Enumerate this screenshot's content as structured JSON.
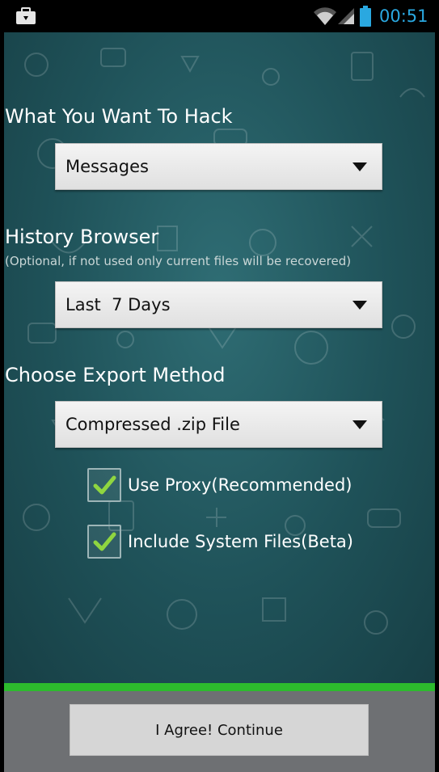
{
  "status_bar": {
    "time": "00:51",
    "left_icon": "briefcase-icon",
    "wifi_icon": "wifi-icon",
    "signal_icon": "signal-icon",
    "battery_icon": "battery-icon",
    "time_color": "#2aa8e0"
  },
  "form": {
    "hack_section": {
      "title": "What You Want To Hack",
      "selected": "Messages"
    },
    "history_section": {
      "title": "History Browser",
      "hint": "(Optional, if not used only current files will be recovered)",
      "selected": "Last  7 Days"
    },
    "export_section": {
      "title": "Choose Export Method",
      "selected": "Compressed .zip File"
    },
    "options": [
      {
        "label": "Use Proxy(Recommended)",
        "checked": true
      },
      {
        "label": "Include System Files(Beta)",
        "checked": true
      }
    ]
  },
  "progress": {
    "value": 1.0,
    "color": "#2dbb2d"
  },
  "footer": {
    "agree_label": "I Agree! Continue"
  },
  "colors": {
    "background": "#1f5259",
    "checkmark": "#8fd640"
  }
}
